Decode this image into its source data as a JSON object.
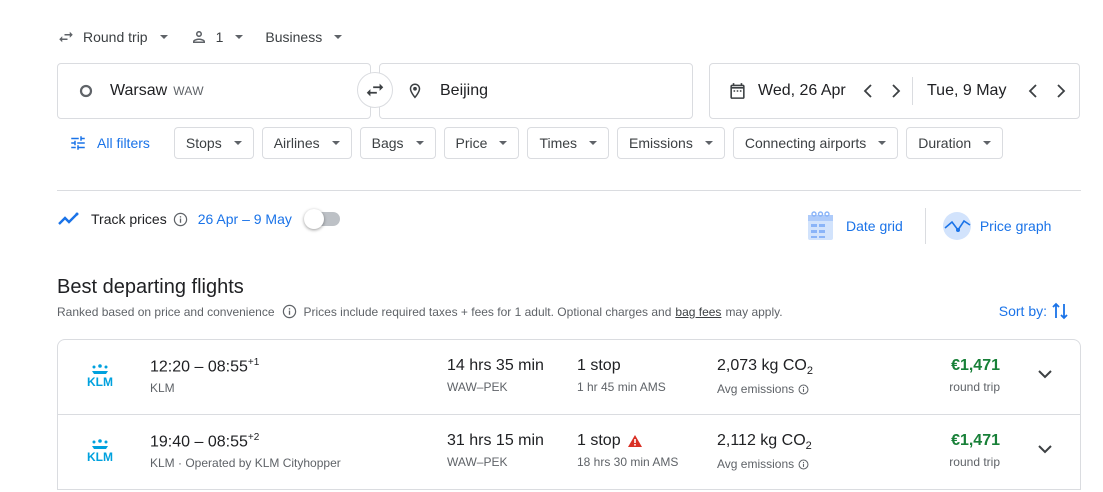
{
  "search": {
    "trip_type": "Round trip",
    "passengers": "1",
    "cabin": "Business",
    "origin_city": "Warsaw",
    "origin_code": "WAW",
    "destination": "Beijing",
    "depart_date": "Wed, 26 Apr",
    "return_date": "Tue, 9 May"
  },
  "filters": {
    "all_filters": "All filters",
    "chips": [
      "Stops",
      "Airlines",
      "Bags",
      "Price",
      "Times",
      "Emissions",
      "Connecting airports",
      "Duration"
    ]
  },
  "track": {
    "label": "Track prices",
    "dates": "26 Apr – 9 May",
    "enabled": false
  },
  "views": {
    "date_grid": "Date grid",
    "price_graph": "Price graph"
  },
  "results": {
    "title": "Best departing flights",
    "subtitle_1": "Ranked based on price and convenience",
    "subtitle_2": "Prices include required taxes + fees for 1 adult. Optional charges and",
    "bag_fees": "bag fees",
    "subtitle_3": "may apply.",
    "sort_label": "Sort by:",
    "flights": [
      {
        "times": "12:20 – 08:55",
        "day_offset": "+1",
        "airline": "KLM",
        "duration": "14 hrs 35 min",
        "route": "WAW–PEK",
        "stops": "1 stop",
        "layover": "1 hr 45 min AMS",
        "emissions": "2,073 kg CO",
        "emissions_sub": "2",
        "emissions_label": "Avg emissions",
        "price": "€1,471",
        "price_note": "round trip",
        "warning": false
      },
      {
        "times": "19:40 – 08:55",
        "day_offset": "+2",
        "airline": "KLM · Operated by KLM Cityhopper",
        "duration": "31 hrs 15 min",
        "route": "WAW–PEK",
        "stops": "1 stop",
        "layover": "18 hrs 30 min AMS",
        "emissions": "2,112 kg CO",
        "emissions_sub": "2",
        "emissions_label": "Avg emissions",
        "price": "€1,471",
        "price_note": "round trip",
        "warning": true
      }
    ]
  },
  "colors": {
    "accent": "#1a73e8",
    "price": "#188038",
    "klm": "#00a1de",
    "warning": "#d93025"
  },
  "icons": [
    "swap-arrows-icon",
    "person-icon",
    "origin-circle-icon",
    "location-pin-icon",
    "calendar-icon",
    "tune-icon",
    "trend-icon",
    "info-icon",
    "date-grid-icon",
    "price-graph-icon",
    "sort-icon",
    "klm-logo",
    "warning-icon",
    "chevron-down-icon"
  ]
}
